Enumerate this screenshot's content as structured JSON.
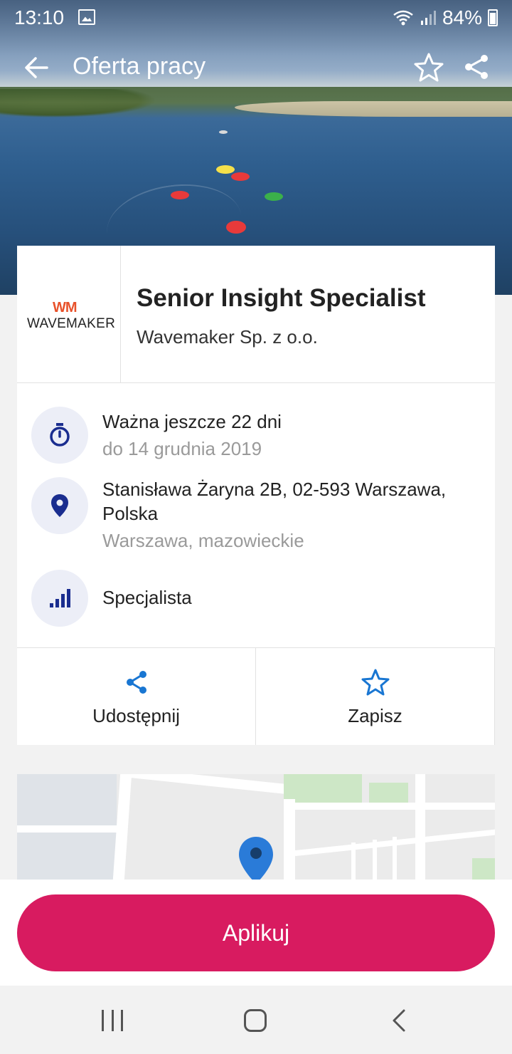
{
  "status_bar": {
    "time": "13:10",
    "battery": "84%"
  },
  "app_bar": {
    "title": "Oferta pracy",
    "icons": [
      "back-arrow-icon",
      "star-outline-icon",
      "share-icon"
    ]
  },
  "job": {
    "title": "Senior Insight Specialist",
    "company": "Wavemaker Sp. z o.o.",
    "logo": {
      "mark": "WM",
      "name": "WAVEMAKER"
    }
  },
  "details": {
    "validity": {
      "icon": "timer-icon",
      "main": "Ważna jeszcze 22 dni",
      "sub": "do 14 grudnia 2019"
    },
    "location": {
      "icon": "location-pin-icon",
      "main_line1": "Stanisława Żaryna 2B, 02-593 Warszawa,",
      "main_line2": "Polska",
      "sub": "Warszawa, mazowieckie"
    },
    "level": {
      "icon": "signal-bars-icon",
      "main": "Specjalista"
    }
  },
  "actions": {
    "share_label": "Udostępnij",
    "save_label": "Zapisz"
  },
  "apply": {
    "label": "Aplikuj"
  },
  "colors": {
    "accent": "#d81b60",
    "icon_blue": "#1a2d8f",
    "action_blue": "#1976d2"
  }
}
